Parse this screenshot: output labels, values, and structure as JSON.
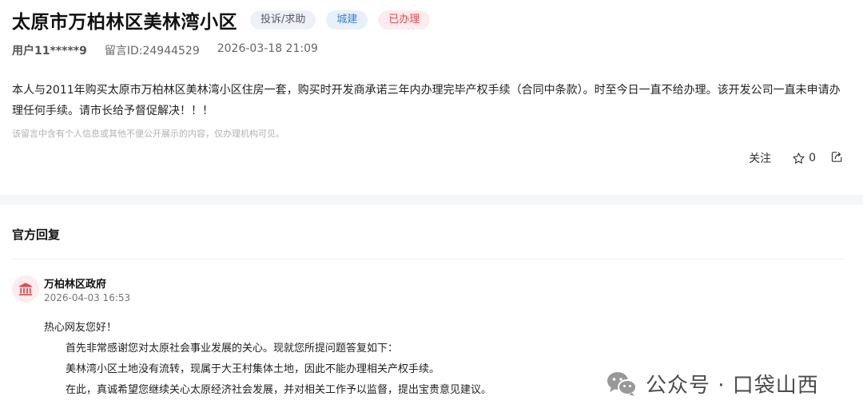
{
  "header": {
    "title": "太原市万柏林区美林湾小区",
    "tags": {
      "category": "投诉/求助",
      "department": "城建",
      "status": "已办理"
    }
  },
  "meta": {
    "user": "用户11*****9",
    "message_id": "留言ID:24944529",
    "datetime": "2026-03-18 21:09"
  },
  "message": {
    "content": "本人与2011年购买太原市万柏林区美林湾小区住房一套，购买时开发商承诺三年内办理完毕产权手续（合同中条款）。时至今日一直不给办理。该开发公司一直未申请办理任何手续。请市长给予督促解决！！！",
    "notice": "该留言中含有个人信息或其他不便公开展示的内容，仅办理机构可见。"
  },
  "actions": {
    "follow_label": "关注",
    "like_count": "0"
  },
  "reply": {
    "heading": "官方回复",
    "org_name": "万柏林区政府",
    "datetime": "2026-04-03 16:53",
    "greeting": "热心网友您好！",
    "lines": [
      "首先非常感谢您对太原社会事业发展的关心。现就您所提问题答复如下：",
      "美林湾小区土地没有流转，现属于大王村集体土地，因此不能办理相关产权手续。",
      "在此，真诚希望您继续关心太原经济社会发展，并对相关工作予以监督，提出宝贵意见建议。"
    ]
  },
  "watermark": {
    "text": "公众号 · 口袋山西",
    "icon": "wechat-icon"
  },
  "colors": {
    "status_red": "#e5474f",
    "dept_blue": "#3e7fd1",
    "band_gray": "#f5f6f8"
  }
}
